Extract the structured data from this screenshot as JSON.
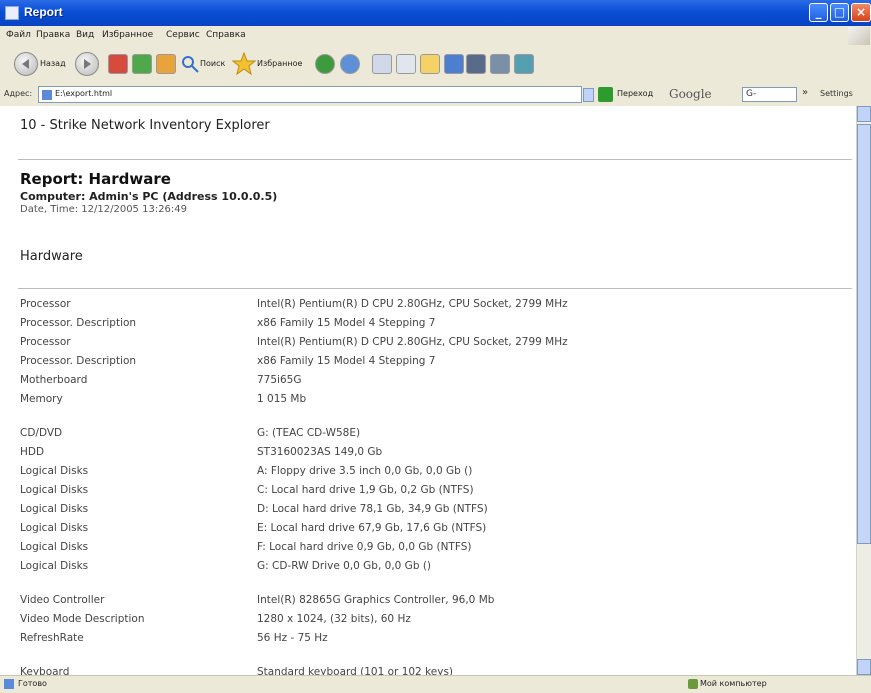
{
  "window": {
    "title": "Report"
  },
  "menu": [
    "Файл",
    "Правка",
    "Вид",
    "Избранное",
    "Сервис",
    "Справка"
  ],
  "toolbar": {
    "back_label": "Назад",
    "search_label": "Поиск",
    "favorites_label": "Избранное"
  },
  "address": {
    "label": "Адрес:",
    "value": "E:\\export.html",
    "go_label": "Переход",
    "google_label": "Google",
    "google_sub": "G-",
    "settings_label": "Settings"
  },
  "page": {
    "app_title": "10 - Strike Network Inventory Explorer",
    "report_title": "Report: Hardware",
    "computer_line": "Computer: Admin's PC (Address 10.0.0.5)",
    "date_line": "Date, Time: 12/12/2005 13:26:49",
    "section_title": "Hardware",
    "rows": [
      {
        "k": "Processor",
        "v": "Intel(R) Pentium(R) D CPU 2.80GHz, CPU Socket, 2799 MHz"
      },
      {
        "k": "Processor. Description",
        "v": "x86 Family 15 Model 4 Stepping 7"
      },
      {
        "k": "Processor",
        "v": "Intel(R) Pentium(R) D CPU 2.80GHz, CPU Socket, 2799 MHz"
      },
      {
        "k": "Processor. Description",
        "v": "x86 Family 15 Model 4 Stepping 7"
      },
      {
        "k": "Motherboard",
        "v": "775i65G"
      },
      {
        "k": "Memory",
        "v": "1 015 Mb"
      },
      {
        "k": "CD/DVD",
        "v": "G: (TEAC CD-W58E)"
      },
      {
        "k": "HDD",
        "v": "ST3160023AS 149,0 Gb"
      },
      {
        "k": "Logical Disks",
        "v": "A: Floppy drive 3.5 inch 0,0 Gb, 0,0 Gb ()"
      },
      {
        "k": "Logical Disks",
        "v": "C: Local hard drive 1,9 Gb, 0,2 Gb (NTFS)"
      },
      {
        "k": "Logical Disks",
        "v": "D: Local hard drive 78,1 Gb, 34,9 Gb (NTFS)"
      },
      {
        "k": "Logical Disks",
        "v": "E: Local hard drive 67,9 Gb, 17,6 Gb (NTFS)"
      },
      {
        "k": "Logical Disks",
        "v": "F: Local hard drive 0,9 Gb, 0,0 Gb (NTFS)"
      },
      {
        "k": "Logical Disks",
        "v": "G: CD-RW Drive 0,0 Gb, 0,0 Gb ()"
      },
      {
        "k": "Video Controller",
        "v": "Intel(R) 82865G Graphics Controller, 96,0 Mb"
      },
      {
        "k": "Video Mode Description",
        "v": "1280 x 1024, (32 bits), 60 Hz"
      },
      {
        "k": "RefreshRate",
        "v": "56 Hz - 75 Hz"
      },
      {
        "k": "Keyboard",
        "v": "Standard keyboard (101 or 102 keys)"
      }
    ]
  },
  "status": {
    "left": "Готово",
    "right": "Мой компьютер"
  }
}
